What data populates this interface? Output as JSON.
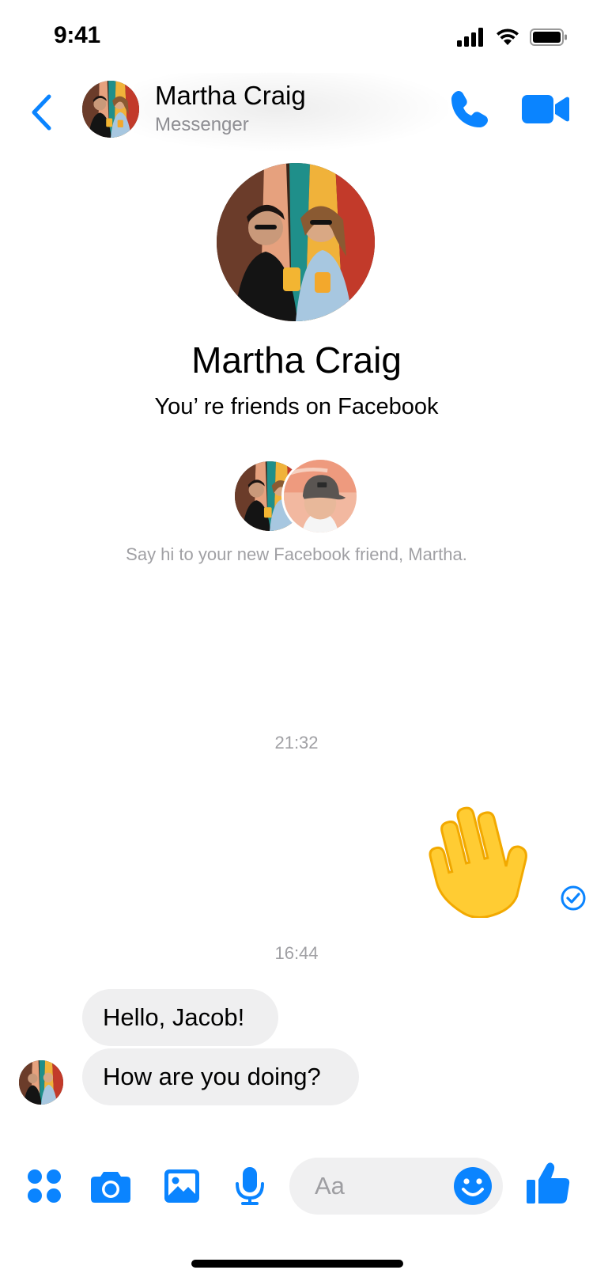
{
  "status_bar": {
    "time": "9:41",
    "icons": [
      "cellular-signal-icon",
      "wifi-icon",
      "battery-icon"
    ]
  },
  "header": {
    "back_icon": "chevron-left-icon",
    "contact_name": "Martha Craig",
    "subtitle": "Messenger",
    "call_icon": "phone-icon",
    "video_icon": "video-camera-icon"
  },
  "profile": {
    "name": "Martha Craig",
    "relationship": "You’ re friends on Facebook",
    "prompt": "Say hi to your new Facebook friend, Martha."
  },
  "conversation": {
    "timestamps": [
      "21:32",
      "16:44"
    ],
    "sent": {
      "emoji": "waving-hand-icon",
      "status_icon": "read-check-icon"
    },
    "received": [
      {
        "text": "Hello, Jacob!"
      },
      {
        "text": "How are you doing?"
      }
    ]
  },
  "composer": {
    "icons": [
      "apps-icon",
      "camera-icon",
      "photo-icon",
      "microphone-icon"
    ],
    "placeholder": "Aa",
    "emoji_icon": "smiley-icon",
    "like_icon": "thumbs-up-icon"
  },
  "colors": {
    "accent": "#0a84ff",
    "bubble": "#efeff0",
    "muted_text": "#a0a0a4",
    "wave_yellow": "#ffcc33"
  }
}
